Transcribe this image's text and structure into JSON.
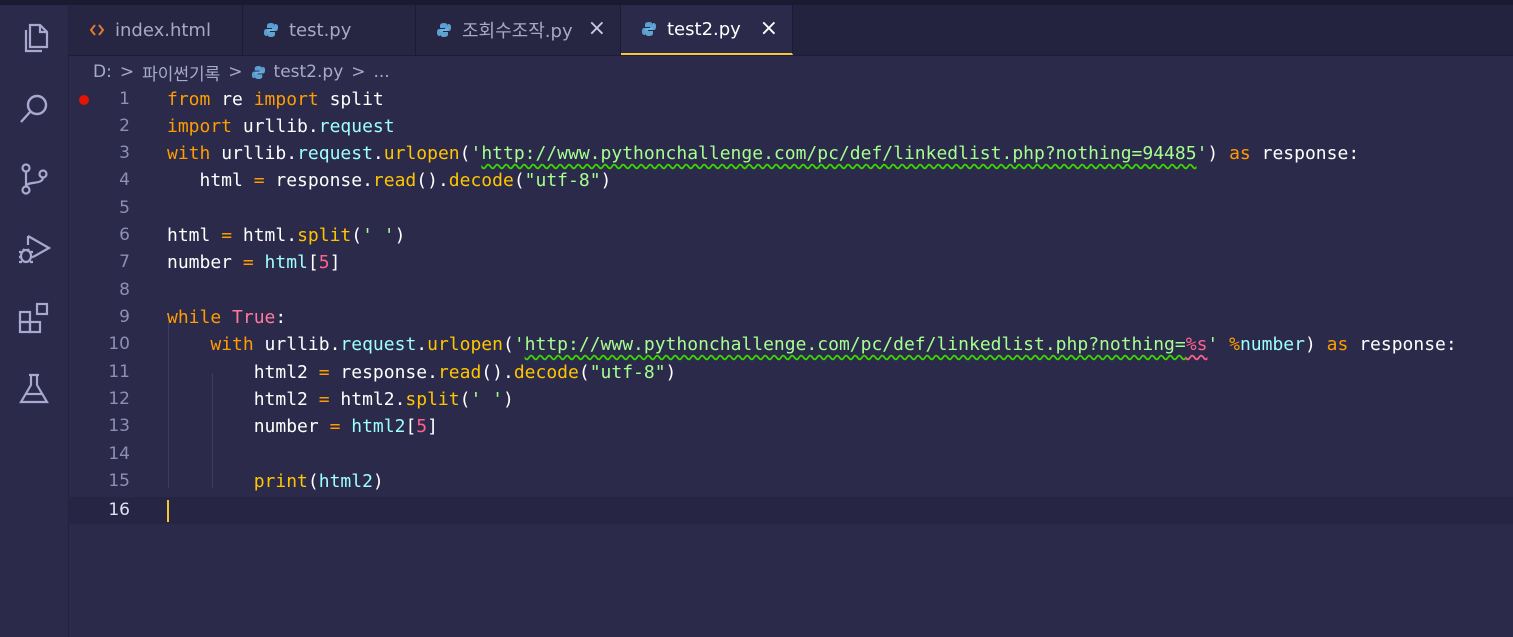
{
  "tabs": [
    {
      "label": "index.html",
      "icon": "html-code-icon",
      "active": false,
      "close": false
    },
    {
      "label": "test.py",
      "icon": "python-icon",
      "active": false,
      "close": false
    },
    {
      "label": "조회수조작.py",
      "icon": "python-icon",
      "active": false,
      "close": true
    },
    {
      "label": "test2.py",
      "icon": "python-icon",
      "active": true,
      "close": true
    }
  ],
  "close_glyph": "×",
  "breadcrumb": {
    "drive": "D:",
    "folder": "파이썬기록",
    "file": "test2.py",
    "more": "...",
    "sep": ">"
  },
  "activity_bar": [
    "explorer-icon",
    "search-icon",
    "source-control-icon",
    "run-debug-icon",
    "extensions-icon",
    "testing-icon"
  ],
  "colors": {
    "background": "#2b2a4a",
    "cursor": "#f3c83a",
    "breakpoint": "#e51400",
    "keyword": "#ff9d00",
    "function": "#ffc600",
    "string": "#a5ff90"
  },
  "line_numbers": [
    "1",
    "2",
    "3",
    "4",
    "5",
    "6",
    "7",
    "8",
    "9",
    "10",
    "11",
    "12",
    "13",
    "14",
    "15",
    "16"
  ],
  "code": {
    "l1": {
      "t1": "from",
      "t2": " re ",
      "t3": "import",
      "t4": " split"
    },
    "l2": {
      "t1": "import",
      "t2": " urllib.",
      "t3": "request"
    },
    "l3": {
      "t1": "with",
      "t2": " urllib.",
      "t3": "request",
      "t4": ".",
      "t5": "urlopen",
      "t6": "(",
      "t7": "'",
      "t8": "http://www.pythonchallenge.com/pc/def/linkedlist.php?nothing=94485",
      "t9": "'",
      "t10": ") ",
      "t11": "as",
      "t12": " response:"
    },
    "l4": {
      "t1": "   html ",
      "t2": "=",
      "t3": " response.",
      "t4": "read",
      "t5": "().",
      "t6": "decode",
      "t7": "(",
      "t8": "\"utf-8\"",
      "t9": ")"
    },
    "l6": {
      "t1": "html ",
      "t2": "=",
      "t3": " html.",
      "t4": "split",
      "t5": "(",
      "t6": "' '",
      "t7": ")"
    },
    "l7": {
      "t1": "number ",
      "t2": "=",
      "t3": " ",
      "t4": "html",
      "t5": "[",
      "t6": "5",
      "t7": "]"
    },
    "l9": {
      "t1": "while",
      "t2": " ",
      "t3": "True",
      "t4": ":"
    },
    "l10": {
      "t1": "    ",
      "t2": "with",
      "t3": " urllib.",
      "t4": "request",
      "t5": ".",
      "t6": "urlopen",
      "t7": "(",
      "t8": "'",
      "t9": "http://www.pythonchallenge.com/pc/def/linkedlist.php?nothing=",
      "t10": "%s",
      "t11": "' ",
      "t12": "%",
      "t13": "number",
      "t14": ") ",
      "t15": "as",
      "t16": " response:"
    },
    "l11": {
      "t1": "        html2 ",
      "t2": "=",
      "t3": " response.",
      "t4": "read",
      "t5": "().",
      "t6": "decode",
      "t7": "(",
      "t8": "\"utf-8\"",
      "t9": ")"
    },
    "l12": {
      "t1": "        html2 ",
      "t2": "=",
      "t3": " html2.",
      "t4": "split",
      "t5": "(",
      "t6": "' '",
      "t7": ")"
    },
    "l13": {
      "t1": "        number ",
      "t2": "=",
      "t3": " ",
      "t4": "html2",
      "t5": "[",
      "t6": "5",
      "t7": "]"
    },
    "l15": {
      "t1": "        ",
      "t2": "print",
      "t3": "(",
      "t4": "html2",
      "t5": ")"
    }
  }
}
